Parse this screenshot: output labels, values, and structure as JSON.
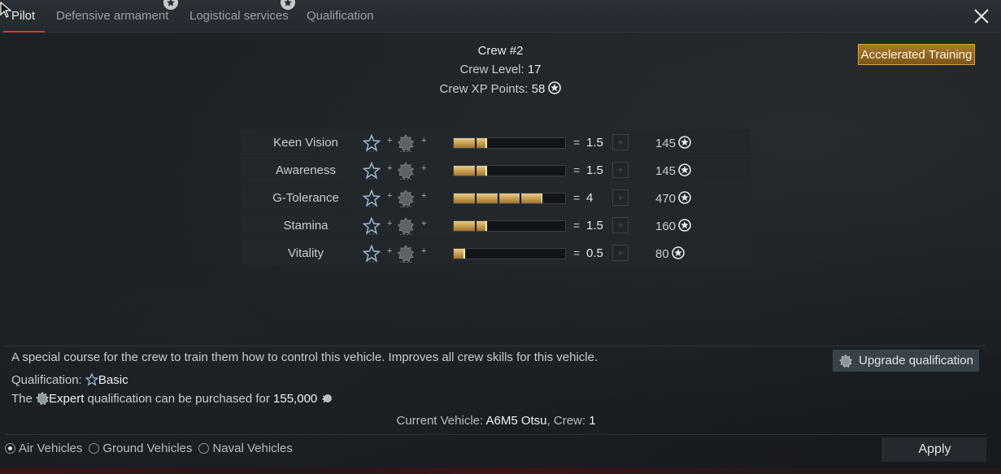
{
  "tabs": [
    {
      "label": "Pilot",
      "active": true
    },
    {
      "label": "Defensive armament",
      "active": false
    },
    {
      "label": "Logistical services",
      "active": false
    },
    {
      "label": "Qualification",
      "active": false
    }
  ],
  "header": {
    "crew_name": "Crew #2",
    "crew_level_label": "Crew Level: ",
    "crew_level_value": "17",
    "crew_xp_label": "Crew XP Points: ",
    "crew_xp_value": "58",
    "accelerated_training_label": "Accelerated Training"
  },
  "skills": [
    {
      "name": "Keen Vision",
      "value": "1.5",
      "cost": "145",
      "progress": 0.3
    },
    {
      "name": "Awareness",
      "value": "1.5",
      "cost": "145",
      "progress": 0.3
    },
    {
      "name": "G-Tolerance",
      "value": "4",
      "cost": "470",
      "progress": 0.8
    },
    {
      "name": "Stamina",
      "value": "1.5",
      "cost": "160",
      "progress": 0.3
    },
    {
      "name": "Vitality",
      "value": "0.5",
      "cost": "80",
      "progress": 0.1
    }
  ],
  "skill_symbols": {
    "plus": "+",
    "equals": "=",
    "increment": "+"
  },
  "qualification": {
    "description": "A special course for the crew to train them how to control this vehicle. Improves all crew skills for this vehicle.",
    "upgrade_label": "Upgrade qualification",
    "current_label": "Qualification: ",
    "current_value": "Basic",
    "expert_prefix": "The ",
    "expert_name": "Expert",
    "expert_middle": " qualification can be purchased for ",
    "expert_price": "155,000",
    "current_vehicle_label": "Current Vehicle: ",
    "current_vehicle_value": "A6M5 Otsu",
    "crew_label": ", Crew: ",
    "crew_value": "1"
  },
  "footer": {
    "vehicle_types": [
      {
        "label": "Air Vehicles",
        "selected": true
      },
      {
        "label": "Ground Vehicles",
        "selected": false
      },
      {
        "label": "Naval Vehicles",
        "selected": false
      }
    ],
    "apply_label": "Apply"
  },
  "colors": {
    "accent_tab": "#c0422f",
    "accel_button": "#a87a2e",
    "bar_fill": "#c69c4e"
  },
  "icons": [
    "cursor-icon",
    "badge-icon",
    "close-icon",
    "crew-xp-icon",
    "basic-qualification-icon",
    "expert-qualification-icon",
    "silver-lions-icon"
  ]
}
